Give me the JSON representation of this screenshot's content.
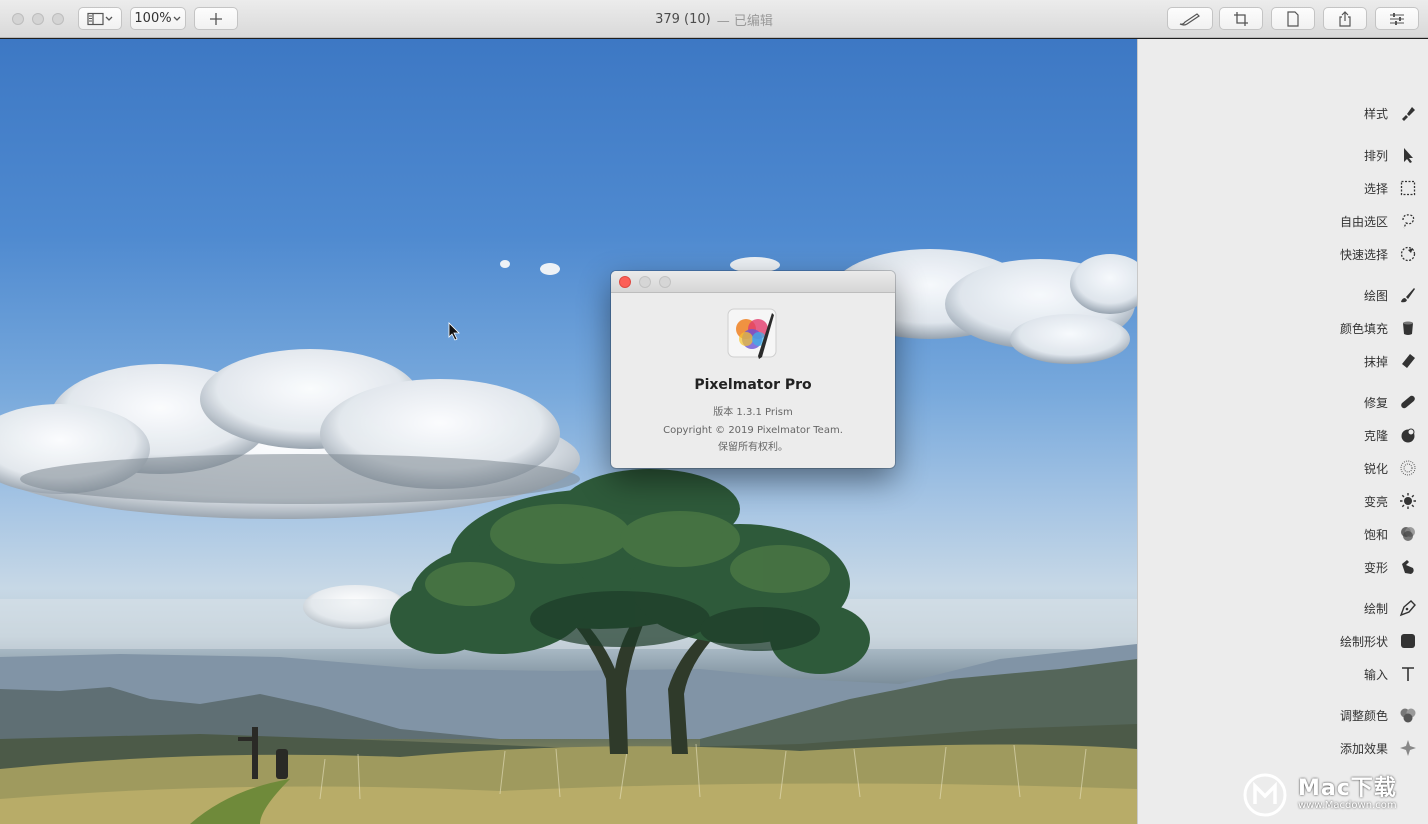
{
  "window": {
    "title": "379 (10)",
    "edited_suffix": "— 已编辑",
    "zoom_value": "100%"
  },
  "about_dialog": {
    "app_name": "Pixelmator Pro",
    "version": "版本 1.3.1 Prism",
    "copyright": "Copyright © 2019 Pixelmator Team.",
    "rights": "保留所有权利。"
  },
  "tools": [
    {
      "label": "样式",
      "icon": "style-brush-icon"
    },
    {
      "label": "排列",
      "icon": "arrow-pointer-icon"
    },
    {
      "label": "选择",
      "icon": "rect-select-icon"
    },
    {
      "label": "自由选区",
      "icon": "lasso-icon"
    },
    {
      "label": "快速选择",
      "icon": "quick-select-icon"
    },
    {
      "label": "绘图",
      "icon": "paint-brush-icon"
    },
    {
      "label": "颜色填充",
      "icon": "paint-bucket-icon"
    },
    {
      "label": "抹掉",
      "icon": "eraser-icon"
    },
    {
      "label": "修复",
      "icon": "bandage-icon"
    },
    {
      "label": "克隆",
      "icon": "clone-icon"
    },
    {
      "label": "锐化",
      "icon": "sharpen-icon"
    },
    {
      "label": "变亮",
      "icon": "sun-icon"
    },
    {
      "label": "饱和",
      "icon": "saturate-icon"
    },
    {
      "label": "变形",
      "icon": "warp-hand-icon"
    },
    {
      "label": "绘制",
      "icon": "pen-nib-icon"
    },
    {
      "label": "绘制形状",
      "icon": "shape-square-icon"
    },
    {
      "label": "输入",
      "icon": "text-t-icon"
    },
    {
      "label": "调整颜色",
      "icon": "color-adjust-icon"
    },
    {
      "label": "添加效果",
      "icon": "effects-star-icon"
    }
  ],
  "watermark": {
    "brand": "Mac下载",
    "url": "www.Macdown.com"
  },
  "colors": {
    "close_red": "#fc5f57",
    "toolbar_bg": "#e4e4e4",
    "sidebar_bg": "#ececec"
  }
}
